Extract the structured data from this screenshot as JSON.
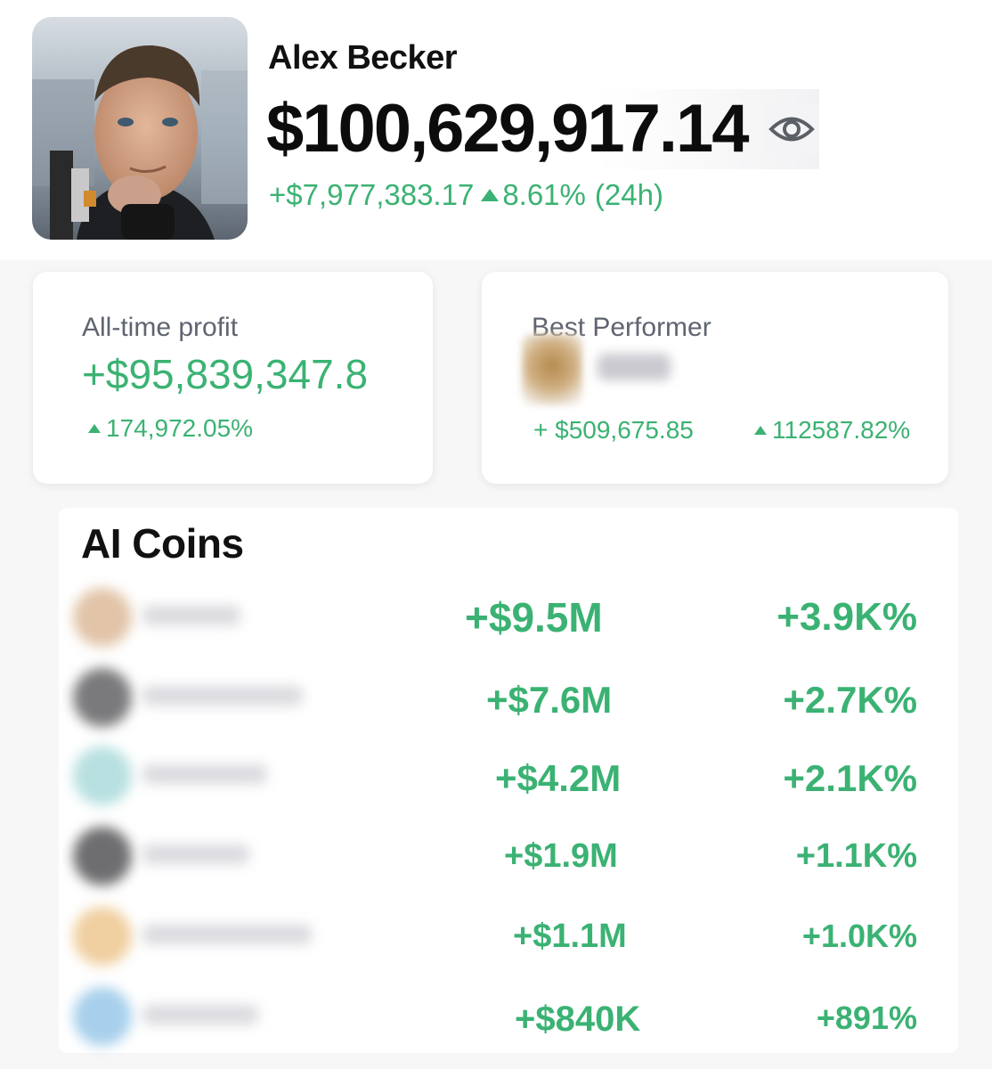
{
  "profile": {
    "name": "Alex Becker",
    "balance": "$100,629,917.14",
    "change_amount": "+$7,977,383.17",
    "change_percent": "8.61%",
    "change_period": "(24h)"
  },
  "cards": {
    "all_time": {
      "label": "All-time profit",
      "value": "+$95,839,347.8",
      "percent": "174,972.05%"
    },
    "best_performer": {
      "label": "Best Performer",
      "amount": "+ $509,675.85",
      "percent": "112587.82%"
    }
  },
  "ai_coins": {
    "title": "AI Coins",
    "rows": [
      {
        "amount": "+$9.5M",
        "percent": "+3.9K%",
        "icon_color": "#e2c4a8"
      },
      {
        "amount": "+$7.6M",
        "percent": "+2.7K%",
        "icon_color": "#7a7a7c"
      },
      {
        "amount": "+$4.2M",
        "percent": "+2.1K%",
        "icon_color": "#b8e0e0"
      },
      {
        "amount": "+$1.9M",
        "percent": "+1.1K%",
        "icon_color": "#6e6e70"
      },
      {
        "amount": "+$1.1M",
        "percent": "+1.0K%",
        "icon_color": "#f0cfa0"
      },
      {
        "amount": "+$840K",
        "percent": "+891%",
        "icon_color": "#a8d0ec"
      }
    ]
  },
  "colors": {
    "positive": "#3bb273",
    "text_primary": "#111111",
    "text_muted": "#5f6470"
  },
  "icons": {
    "visibility": "eye-icon",
    "up_indicator": "triangle-up-icon"
  }
}
